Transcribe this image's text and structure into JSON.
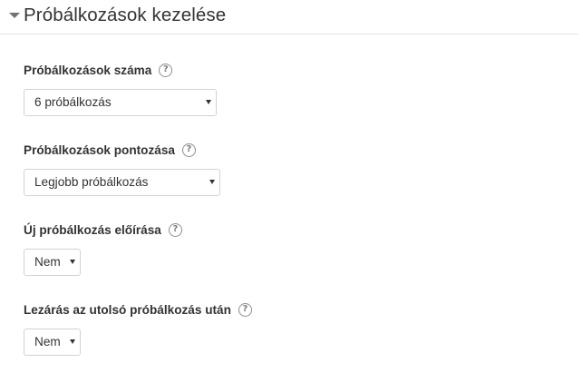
{
  "section": {
    "title": "Próbálkozások kezelése",
    "collapse_icon": "caret-down-icon"
  },
  "fields": [
    {
      "label": "Próbálkozások száma",
      "help_icon": "question-circle-icon",
      "help_glyph": "?",
      "value": "6 próbálkozás"
    },
    {
      "label": "Próbálkozások pontozása",
      "help_icon": "question-circle-icon",
      "help_glyph": "?",
      "value": "Legjobb próbálkozás"
    },
    {
      "label": "Új próbálkozás előírása",
      "help_icon": "question-circle-icon",
      "help_glyph": "?",
      "value": "Nem"
    },
    {
      "label": "Lezárás az utolsó próbálkozás után",
      "help_icon": "question-circle-icon",
      "help_glyph": "?",
      "value": "Nem"
    }
  ]
}
